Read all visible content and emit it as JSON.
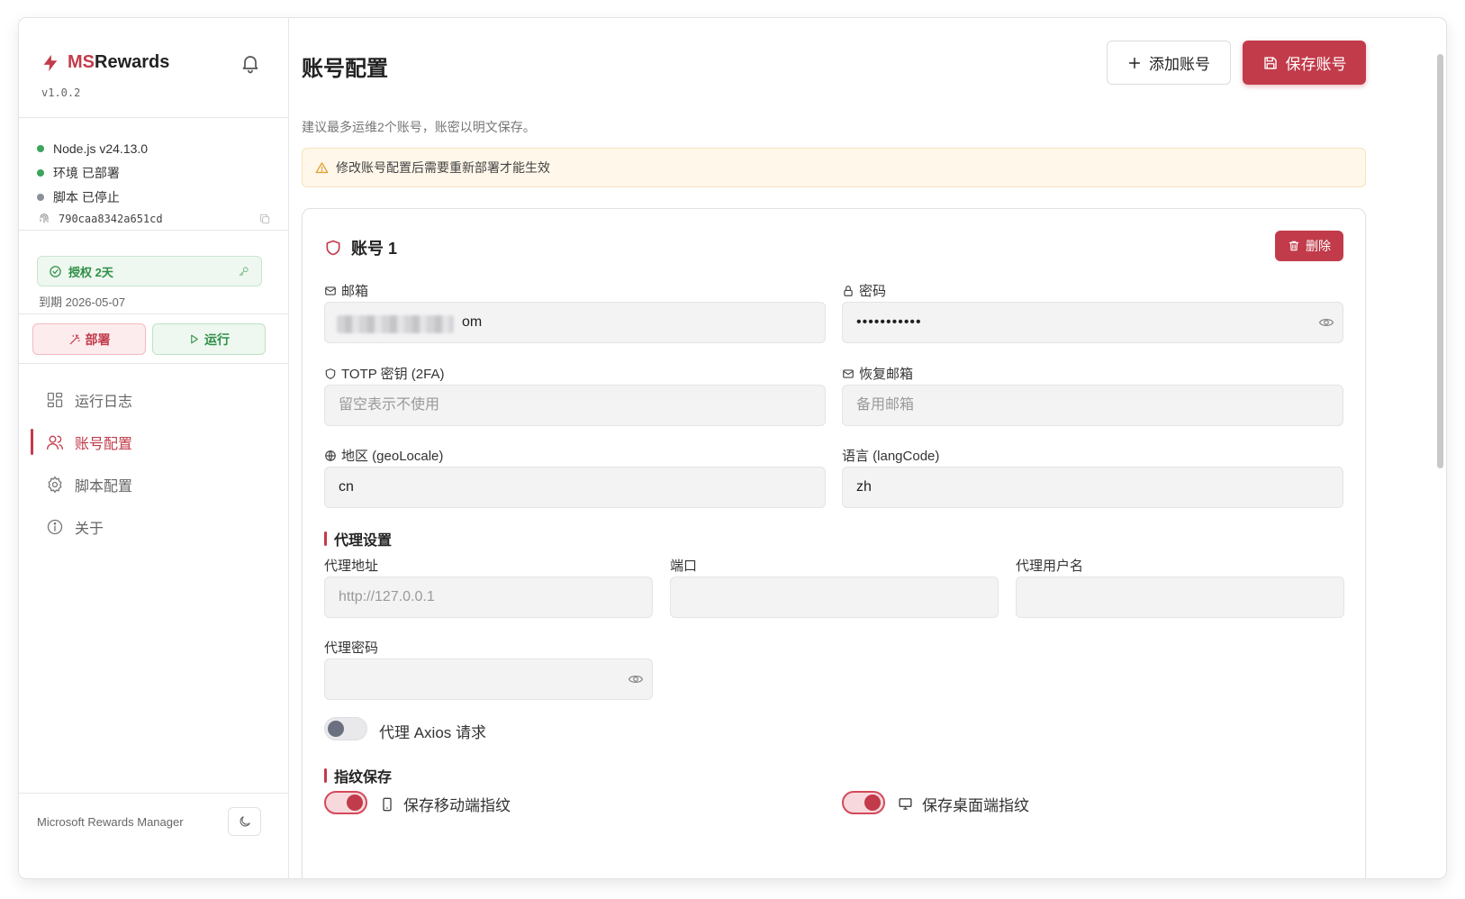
{
  "sidebar": {
    "brand": {
      "prefix": "MS",
      "suffix": "Rewards"
    },
    "version": "v1.0.2",
    "status": [
      {
        "label": "Node.js v24.13.0",
        "color": "#3ba55c"
      },
      {
        "label": "环境 已部署",
        "color": "#3ba55c"
      },
      {
        "label": "脚本 已停止",
        "color": "#8a8f98"
      }
    ],
    "fingerprint": "790caa8342a651cd",
    "license": {
      "label": "授权 2天",
      "expire": "到期 2026-05-07"
    },
    "actions": {
      "deploy": "部署",
      "run": "运行"
    },
    "nav": [
      {
        "label": "运行日志",
        "icon": "grid-icon"
      },
      {
        "label": "账号配置",
        "icon": "users-icon",
        "active": true
      },
      {
        "label": "脚本配置",
        "icon": "gear-icon"
      },
      {
        "label": "关于",
        "icon": "info-icon"
      }
    ],
    "footer": "Microsoft Rewards Manager"
  },
  "main": {
    "title": "账号配置",
    "add_label": "添加账号",
    "save_label": "保存账号",
    "hint": "建议最多运维2个账号，账密以明文保存。",
    "warning": "修改账号配置后需要重新部署才能生效",
    "account": {
      "title": "账号 1",
      "delete_label": "删除",
      "email": {
        "label": "邮箱",
        "value": "om"
      },
      "password": {
        "label": "密码",
        "value": "•••••••••••"
      },
      "totp": {
        "label": "TOTP 密钥 (2FA)",
        "placeholder": "留空表示不使用"
      },
      "recovery": {
        "label": "恢复邮箱",
        "placeholder": "备用邮箱"
      },
      "geo": {
        "label": "地区 (geoLocale)",
        "value": "cn"
      },
      "lang": {
        "label": "语言 (langCode)",
        "value": "zh"
      },
      "proxy": {
        "section": "代理设置",
        "address": {
          "label": "代理地址",
          "placeholder": "http://127.0.0.1"
        },
        "port": {
          "label": "端口",
          "value": ""
        },
        "username": {
          "label": "代理用户名",
          "value": ""
        },
        "password": {
          "label": "代理密码",
          "value": ""
        },
        "axios_label": "代理 Axios 请求",
        "axios_on": false
      },
      "fingerprint": {
        "section": "指纹保存",
        "mobile_label": "保存移动端指纹",
        "mobile_on": true,
        "desktop_label": "保存桌面端指纹",
        "desktop_on": true
      }
    }
  },
  "colors": {
    "accent": "#c23b4a",
    "success": "#3ba55c",
    "muted": "#8a8f98"
  }
}
